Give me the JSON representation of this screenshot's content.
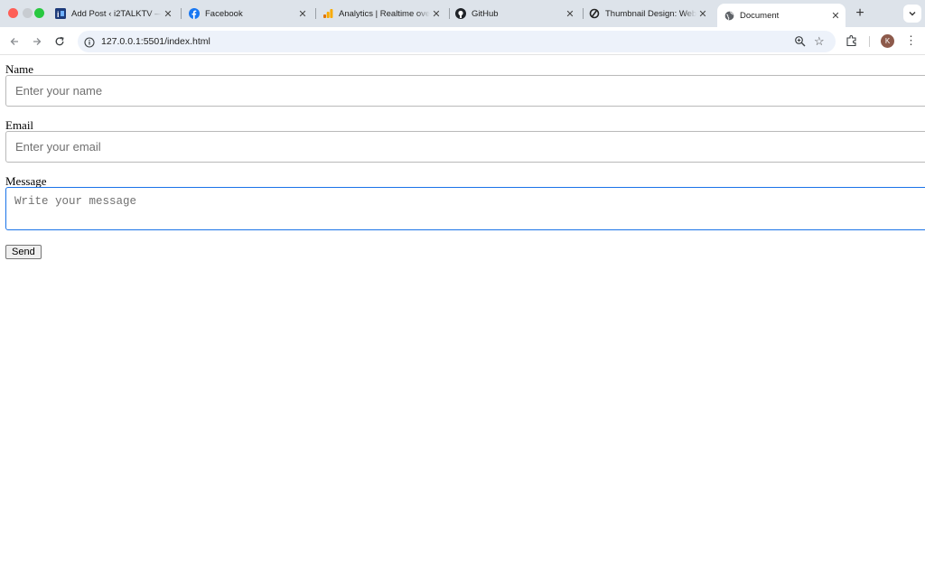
{
  "browser": {
    "tabs": [
      {
        "title": "Add Post ‹ i2TALKTV —",
        "icon": "i2talktv-icon"
      },
      {
        "title": "Facebook",
        "icon": "facebook-icon"
      },
      {
        "title": "Analytics | Realtime over",
        "icon": "analytics-icon"
      },
      {
        "title": "GitHub",
        "icon": "github-icon"
      },
      {
        "title": "Thumbnail Design: Web",
        "icon": "thumbnail-icon"
      },
      {
        "title": "Document",
        "icon": "globe-icon",
        "active": true
      }
    ],
    "new_tab": "+",
    "tab_menu": "⌄",
    "url": "127.0.0.1:5501/index.html",
    "avatar_initial": "K"
  },
  "form": {
    "name_label": "Name",
    "name_placeholder": "Enter your name",
    "email_label": "Email",
    "email_placeholder": "Enter your email",
    "message_label": "Message",
    "message_placeholder": "Write your message",
    "send_label": "Send"
  },
  "colors": {
    "tabstrip": "#dde3ea",
    "omnibox": "#edf2fa",
    "focus": "#1a73e8"
  }
}
